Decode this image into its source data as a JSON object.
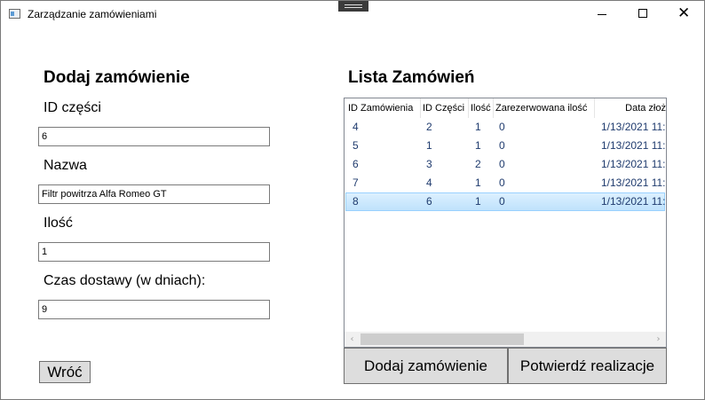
{
  "window": {
    "title": "Zarządzanie zamówieniami",
    "minimize_glyph": "",
    "close_glyph": "✕"
  },
  "left": {
    "heading": "Dodaj zamówienie",
    "part_id_label": "ID części",
    "part_id_value": "6",
    "name_label": "Nazwa",
    "name_value": "Filtr powitrza Alfa Romeo GT",
    "qty_label": "Ilość",
    "qty_value": "1",
    "delivery_label": "Czas dostawy (w dniach):",
    "delivery_value": "9",
    "back_button": "Wróć"
  },
  "right": {
    "heading": "Lista Zamówień",
    "columns": [
      "ID Zamówienia",
      "ID Części",
      "Ilość",
      "Zarezerwowana ilość",
      "Data złoż"
    ],
    "rows": [
      {
        "order_id": "4",
        "part_id": "2",
        "qty": "1",
        "reserved": "0",
        "date": "1/13/2021 11:"
      },
      {
        "order_id": "5",
        "part_id": "1",
        "qty": "1",
        "reserved": "0",
        "date": "1/13/2021 11:"
      },
      {
        "order_id": "6",
        "part_id": "3",
        "qty": "2",
        "reserved": "0",
        "date": "1/13/2021 11:"
      },
      {
        "order_id": "7",
        "part_id": "4",
        "qty": "1",
        "reserved": "0",
        "date": "1/13/2021 11:"
      },
      {
        "order_id": "8",
        "part_id": "6",
        "qty": "1",
        "reserved": "0",
        "date": "1/13/2021 11:"
      }
    ],
    "selected_row": 4,
    "add_button": "Dodaj zamówienie",
    "confirm_button": "Potwierdź realizacje"
  },
  "scrollbar": {
    "left_arrow": "‹",
    "right_arrow": "›"
  },
  "colors": {
    "selection": "#cce8ff",
    "button_face": "#dddddd",
    "cell_text": "#1f3b6e"
  }
}
